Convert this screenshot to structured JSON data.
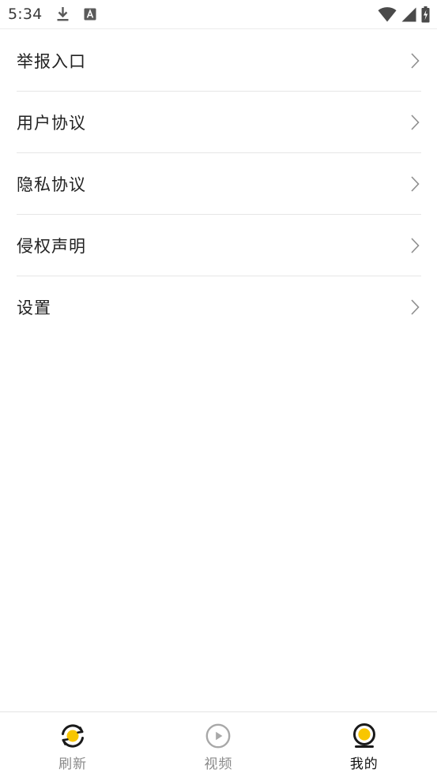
{
  "status_bar": {
    "time": "5:34",
    "icons": [
      "download-icon",
      "a-badge-icon",
      "wifi-icon",
      "cell-signal-icon",
      "battery-charging-icon"
    ]
  },
  "menu": {
    "items": [
      {
        "label": "举报入口",
        "icon": "chevron-right-icon"
      },
      {
        "label": "用户协议",
        "icon": "chevron-right-icon"
      },
      {
        "label": "隐私协议",
        "icon": "chevron-right-icon"
      },
      {
        "label": "侵权声明",
        "icon": "chevron-right-icon"
      },
      {
        "label": "设置",
        "icon": "chevron-right-icon"
      }
    ]
  },
  "bottom_nav": {
    "accent_color": "#F8C600",
    "active_color": "#111111",
    "inactive_color": "#8A8A8A",
    "items": [
      {
        "label": "刷新",
        "icon": "refresh-icon",
        "active": false
      },
      {
        "label": "视频",
        "icon": "play-circle-icon",
        "active": false
      },
      {
        "label": "我的",
        "icon": "profile-icon",
        "active": true
      }
    ]
  }
}
